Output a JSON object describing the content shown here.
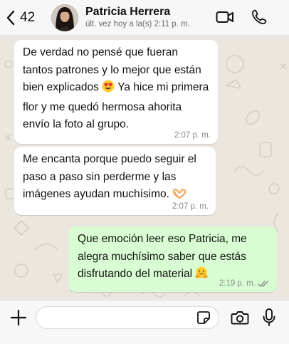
{
  "header": {
    "back_count": "42",
    "contact_name": "Patricia Herrera",
    "status": "últ. vez hoy a la(s) 2:11 p. m."
  },
  "messages": [
    {
      "direction": "incoming",
      "text_before_emoji": "De verdad no pensé que fueran tantos patrones y lo mejor que están bien explicados",
      "emoji": "heart-eyes",
      "text_after_emoji": " Ya hice mi primera flor y me quedó hermosa ahorita envío la foto al grupo.",
      "time": "2:07 p. m."
    },
    {
      "direction": "incoming",
      "text": "Me encanta porque puedo seguir el paso a paso sin perderme y las imágenes ayudan muchísimo.",
      "emoji": "heart-hands",
      "time": "2:07 p. m."
    },
    {
      "direction": "outgoing",
      "text": "Que emoción leer eso Patricia, me alegra muchísimo saber que estás disfrutando del material",
      "emoji": "hugging-face",
      "time": "2:19 p. m.",
      "status": "read"
    }
  ],
  "input": {
    "value": "",
    "placeholder": ""
  },
  "colors": {
    "outgoing_bubble": "#d9fdd3",
    "incoming_bubble": "#ffffff",
    "read_ticks": "#8a8a8a"
  }
}
